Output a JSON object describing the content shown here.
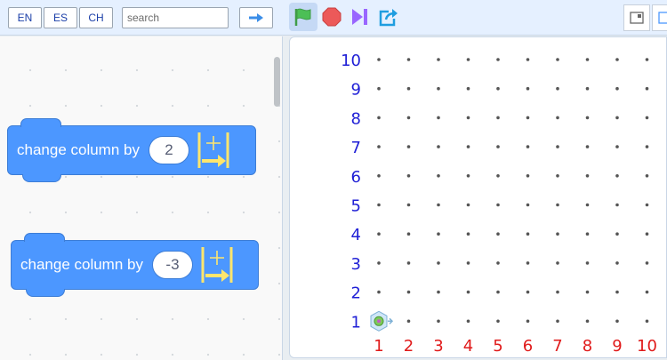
{
  "toolbar": {
    "languages": [
      "EN",
      "ES",
      "CH"
    ],
    "search": {
      "placeholder": "search",
      "value": ""
    },
    "icons": {
      "go": "arrow-right-icon",
      "green_flag": "green-flag-icon",
      "stop": "stop-icon",
      "step": "step-forward-icon",
      "share": "share-icon",
      "layout_small": "small-stage-icon",
      "layout_large": "large-stage-icon"
    }
  },
  "code": {
    "blocks": [
      {
        "label": "change column by",
        "value": "2"
      },
      {
        "label": "change column by",
        "value": "-3"
      }
    ]
  },
  "stage": {
    "row_labels": [
      "10",
      "9",
      "8",
      "7",
      "6",
      "5",
      "4",
      "3",
      "2",
      "1"
    ],
    "column_labels": [
      "1",
      "2",
      "3",
      "4",
      "5",
      "6",
      "7",
      "8",
      "9",
      "10"
    ],
    "sprite": {
      "name": "turtle",
      "column": 1,
      "row": 1
    }
  },
  "colors": {
    "block_blue": "#4c97ff",
    "row_label": "#1f1fd6",
    "column_label": "#e01a1a",
    "flag_green": "#4cbf56",
    "stop_red": "#ec5959",
    "step_purple": "#9966ff",
    "share_blue": "#1f9de0"
  }
}
